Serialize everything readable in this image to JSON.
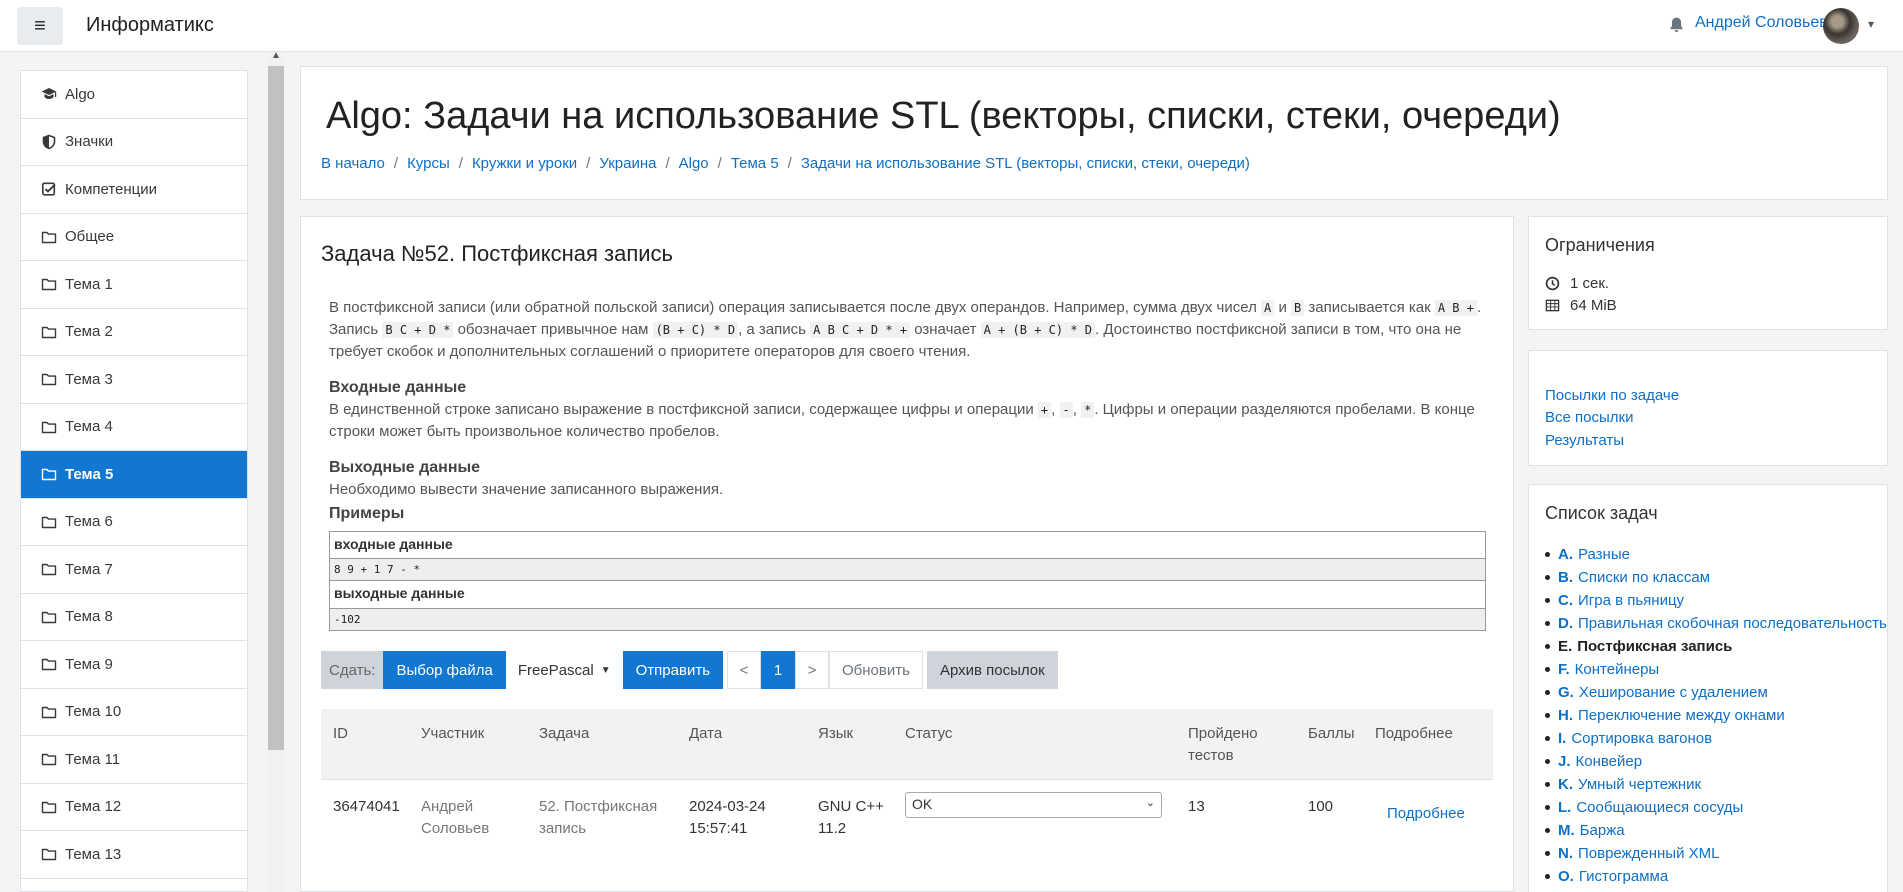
{
  "topbar": {
    "site_name": "Информатикс",
    "user_name": "Андрей Соловьев"
  },
  "sidebar": {
    "items": [
      {
        "label": "Algo",
        "icon": "graduation-cap-icon"
      },
      {
        "label": "Значки",
        "icon": "shield-icon"
      },
      {
        "label": "Компетенции",
        "icon": "checkbox-icon"
      },
      {
        "label": "Общее",
        "icon": "folder-icon"
      },
      {
        "label": "Тема 1",
        "icon": "folder-icon"
      },
      {
        "label": "Тема 2",
        "icon": "folder-icon"
      },
      {
        "label": "Тема 3",
        "icon": "folder-icon"
      },
      {
        "label": "Тема 4",
        "icon": "folder-icon"
      },
      {
        "label": "Тема 5",
        "icon": "folder-icon",
        "active": true
      },
      {
        "label": "Тема 6",
        "icon": "folder-icon"
      },
      {
        "label": "Тема 7",
        "icon": "folder-icon"
      },
      {
        "label": "Тема 8",
        "icon": "folder-icon"
      },
      {
        "label": "Тема 9",
        "icon": "folder-icon"
      },
      {
        "label": "Тема 10",
        "icon": "folder-icon"
      },
      {
        "label": "Тема 11",
        "icon": "folder-icon"
      },
      {
        "label": "Тема 12",
        "icon": "folder-icon"
      },
      {
        "label": "Тема 13",
        "icon": "folder-icon"
      }
    ]
  },
  "header": {
    "title": "Algo: Задачи на использование STL (векторы, списки, стеки, очереди)",
    "breadcrumb": [
      "В начало",
      "Курсы",
      "Кружки и уроки",
      "Украина",
      "Algo",
      "Тема 5",
      "Задачи на использование STL (векторы, списки, стеки, очереди)"
    ]
  },
  "problem": {
    "title": "Задача №52. Постфиксная запись",
    "p1_a": "В постфиксной записи (или обратной польской записи) операция записывается после двух операндов. Например, сумма двух чисел",
    "p1_c1": "A",
    "p1_b": "и",
    "p1_c2": "B",
    "p1_c": "записывается как",
    "p1_c3": "A B +",
    "p1_d": ". Запись",
    "p1_c4": "B C + D *",
    "p1_e": "обозначает привычное нам",
    "p1_c5": "(B + C) * D",
    "p1_f": ", а запись",
    "p1_c6": "A B C + D * +",
    "p1_g": "означает",
    "p1_c7": "A + (B + C) * D",
    "p1_h": ". Достоинство постфиксной записи в том, что она не требует скобок и дополнительных соглашений о приоритете операторов для своего чтения.",
    "input_h": "Входные данные",
    "input_a": "В единственной строке записано выражение в постфиксной записи, содержащее цифры и операции",
    "op1": "+",
    "op2": "-",
    "op3": "*",
    "input_b": ". Цифры и операции разделяются пробелами. В конце строки может быть произвольное количество пробелов.",
    "output_h": "Выходные данные",
    "output_text": "Необходимо вывести значение записанного выражения.",
    "examples_h": "Примеры",
    "ex_in_label": "входные данные",
    "ex_in": "8 9 + 1 7 - *",
    "ex_out_label": "выходные данные",
    "ex_out": "-102"
  },
  "toolbar": {
    "submit_label": "Сдать:",
    "choose_file": "Выбор файла",
    "language": "FreePascal",
    "send": "Отправить",
    "prev": "<",
    "page": "1",
    "next": ">",
    "refresh": "Обновить",
    "archive": "Архив посылок"
  },
  "submissions": {
    "headers": {
      "id": "ID",
      "user": "Участник",
      "task": "Задача",
      "date": "Дата",
      "lang": "Язык",
      "status": "Статус",
      "tests": "Пройдено тестов",
      "score": "Баллы",
      "details": "Подробнее"
    },
    "rows": [
      {
        "id": "36474041",
        "user": "Андрей Соловьев",
        "task": "52. Постфиксная запись",
        "date": "2024-03-24 15:57:41",
        "lang": "GNU C++ 11.2",
        "status": "OK",
        "tests": "13",
        "score": "100",
        "details": "Подробнее"
      }
    ]
  },
  "limits": {
    "title": "Ограничения",
    "time": "1 сек.",
    "memory": "64 MiB"
  },
  "links": {
    "by_task": "Посылки по задаче",
    "all": "Все посылки",
    "results": "Результаты"
  },
  "tasks": {
    "title": "Список задач",
    "items": [
      {
        "letter": "A.",
        "name": "Разные"
      },
      {
        "letter": "B.",
        "name": "Списки по классам"
      },
      {
        "letter": "C.",
        "name": "Игра в пьяницу"
      },
      {
        "letter": "D.",
        "name": "Правильная скобочная последовательность"
      },
      {
        "letter": "E.",
        "name": "Постфиксная запись",
        "current": true
      },
      {
        "letter": "F.",
        "name": "Контейнеры"
      },
      {
        "letter": "G.",
        "name": "Хеширование с удалением"
      },
      {
        "letter": "H.",
        "name": "Переключение между окнами"
      },
      {
        "letter": "I.",
        "name": "Сортировка вагонов"
      },
      {
        "letter": "J.",
        "name": "Конвейер"
      },
      {
        "letter": "K.",
        "name": "Умный чертежник"
      },
      {
        "letter": "L.",
        "name": "Сообщающиеся сосуды"
      },
      {
        "letter": "M.",
        "name": "Баржа"
      },
      {
        "letter": "N.",
        "name": "Поврежденный XML"
      },
      {
        "letter": "O.",
        "name": "Гистограмма"
      }
    ]
  }
}
